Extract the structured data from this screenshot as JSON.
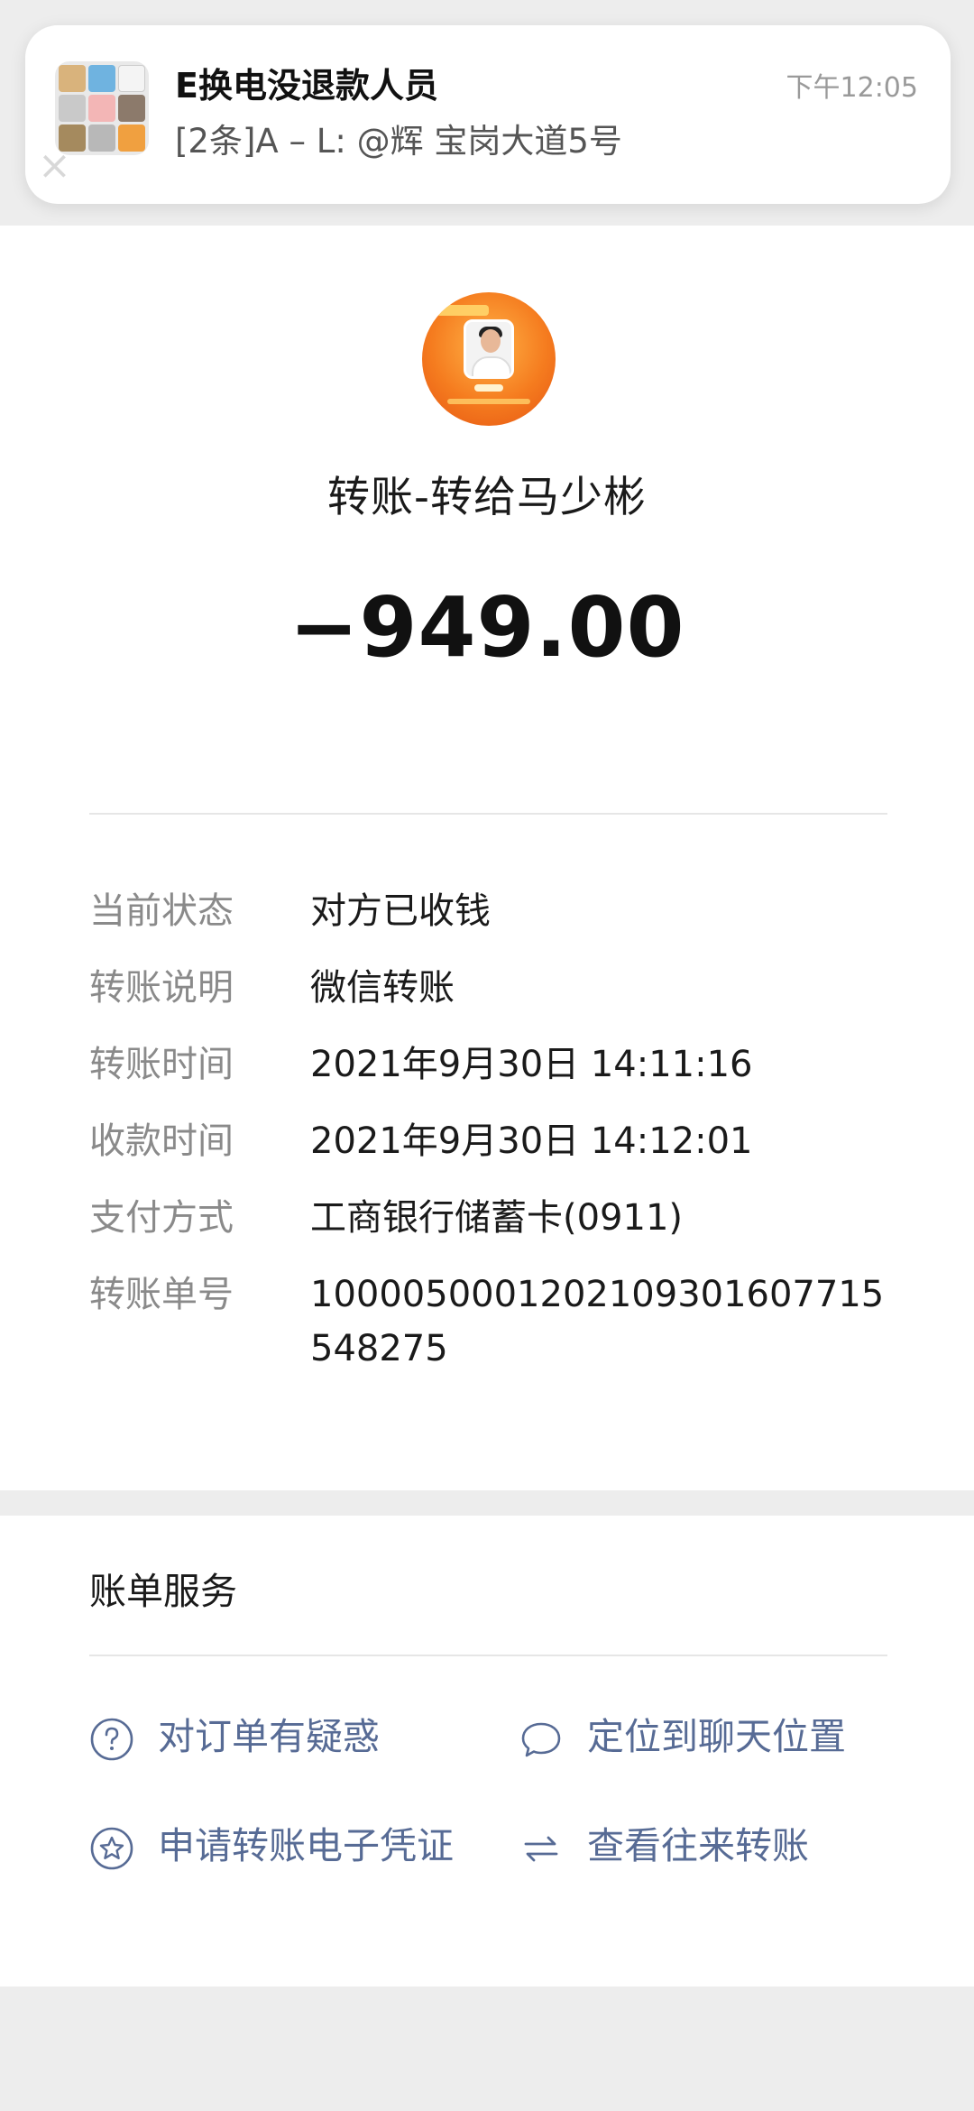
{
  "notification": {
    "title": "E换电没退款人员",
    "body": "[2条]A – L: @辉 宝岗大道5号",
    "time": "下午12:05",
    "close_glyph": "×"
  },
  "transfer": {
    "title": "转账-转给马少彬",
    "amount": "−949.00",
    "rows": [
      {
        "label": "当前状态",
        "value": "对方已收钱"
      },
      {
        "label": "转账说明",
        "value": "微信转账"
      },
      {
        "label": "转账时间",
        "value": "2021年9月30日 14:11:16"
      },
      {
        "label": "收款时间",
        "value": "2021年9月30日 14:12:01"
      },
      {
        "label": "支付方式",
        "value": "工商银行储蓄卡(0911)"
      },
      {
        "label": "转账单号",
        "value": "1000050001202109301607715548275"
      }
    ]
  },
  "services": {
    "heading": "账单服务",
    "items": [
      {
        "label": "对订单有疑惑",
        "icon": "question-circle-icon"
      },
      {
        "label": "定位到聊天位置",
        "icon": "chat-bubble-icon"
      },
      {
        "label": "申请转账电子凭证",
        "icon": "star-circle-icon"
      },
      {
        "label": "查看往来转账",
        "icon": "swap-arrows-icon"
      }
    ]
  },
  "colors": {
    "link": "#576b95",
    "label": "#8a8a8a",
    "background": "#ededed"
  }
}
